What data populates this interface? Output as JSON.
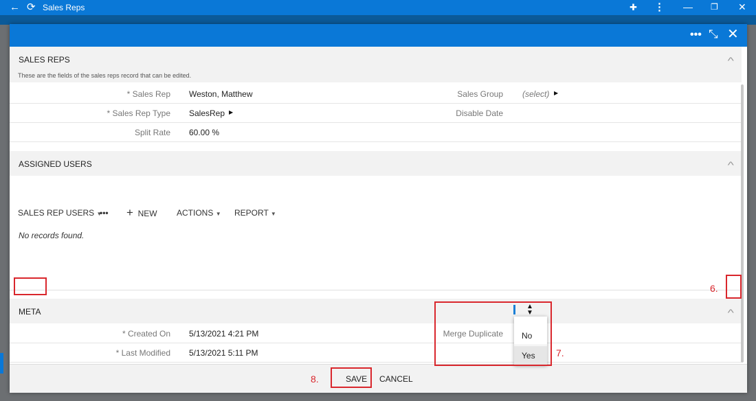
{
  "window": {
    "title": "Sales Reps",
    "back_icon": "←",
    "refresh_icon": "⟳",
    "extension_icon": "✚",
    "more_icon": "⋮",
    "minimize_icon": "—",
    "maximize_icon": "❐",
    "close_icon": "✕"
  },
  "dialog": {
    "more_icon": "•••",
    "collapse_icon": "⤡",
    "close_icon": "✕"
  },
  "sales_reps": {
    "title": "SALES REPS",
    "description": "These are the fields of the sales reps record that can be edited.",
    "fields": {
      "sales_rep_label": "* Sales Rep",
      "sales_rep_value": "Weston, Matthew",
      "sales_rep_type_label": "* Sales Rep Type",
      "sales_rep_type_value": "SalesRep",
      "split_rate_label": "Split Rate",
      "split_rate_value": "60.00 %",
      "sales_group_label": "Sales Group",
      "sales_group_value": "(select)",
      "disable_date_label": "Disable Date",
      "disable_date_value": ""
    }
  },
  "assigned_users": {
    "title": "ASSIGNED USERS",
    "toolbar": {
      "view_label": "SALES REP USERS",
      "more_label": "•••",
      "new_label": "NEW",
      "new_icon": "+",
      "actions_label": "ACTIONS",
      "report_label": "REPORT"
    },
    "empty_text": "No records found."
  },
  "meta": {
    "title": "META",
    "fields": {
      "created_on_label": "* Created On",
      "created_on_value": "5/13/2021 4:21 PM",
      "last_modified_label": "* Last Modified",
      "last_modified_value": "5/13/2021 5:11 PM",
      "merge_duplicate_label": "Merge Duplicate"
    },
    "merge_options": [
      "",
      "No",
      "Yes"
    ]
  },
  "annotations": {
    "step6": "6.",
    "step7": "7.",
    "step8": "8."
  },
  "footer": {
    "save_label": "SAVE",
    "cancel_label": "CANCEL"
  },
  "colors": {
    "accent": "#0a78d7",
    "annotation": "#d9262c"
  }
}
